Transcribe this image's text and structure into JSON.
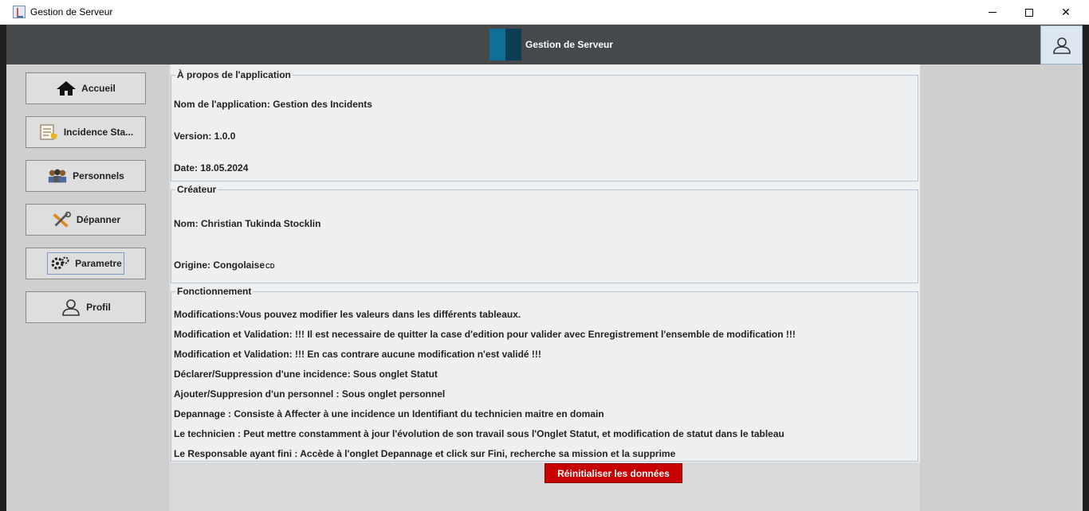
{
  "window": {
    "title": "Gestion de Serveur"
  },
  "header": {
    "title": "Gestion de Serveur",
    "logo_colors": [
      "#0f6f95",
      "#0d3d52"
    ]
  },
  "sidebar": {
    "items": [
      {
        "label": "Accueil",
        "icon": "home-icon"
      },
      {
        "label": "Incidence Sta...",
        "icon": "incident-icon"
      },
      {
        "label": "Personnels",
        "icon": "people-icon"
      },
      {
        "label": "Dépanner",
        "icon": "tools-icon"
      },
      {
        "label": "Parametre",
        "icon": "gear-icon"
      },
      {
        "label": "Profil",
        "icon": "user-icon"
      }
    ]
  },
  "about": {
    "legend": "À propos de l'application",
    "app_name": "Nom de l'application: Gestion des Incidents",
    "version": "Version: 1.0.0",
    "date": "Date: 18.05.2024"
  },
  "creator": {
    "legend": "Créateur",
    "name": "Nom: Christian Tukinda Stocklin",
    "origin": "Origine: Congolaise",
    "origin_suffix": "CD"
  },
  "functioning": {
    "legend": "Fonctionnement",
    "lines": [
      "Modifications:Vous pouvez modifier les valeurs dans les différents tableaux.",
      "Modification et Validation: !!! Il est necessaire de quitter la case d'edition pour valider avec Enregistrement l'ensemble de modification !!!",
      "Modification et Validation: !!! En cas contrare aucune modification n'est validé !!!",
      "Déclarer/Suppression d'une incidence: Sous onglet Statut",
      "Ajouter/Suppresion d'un personnel : Sous onglet personnel",
      "Depannage : Consiste à Affecter à une incidence un Identifiant du technicien maitre en domain",
      "Le technicien : Peut mettre constamment à jour l'évolution de son travail sous l'Onglet Statut, et modification de statut dans le tableau",
      "Le Responsable ayant fini : Accède à l'onglet Depannage et click sur Fini, recherche sa mission et la supprime"
    ]
  },
  "actions": {
    "reset_label": "Réinitialiser les données",
    "reset_color": "#c80000"
  }
}
